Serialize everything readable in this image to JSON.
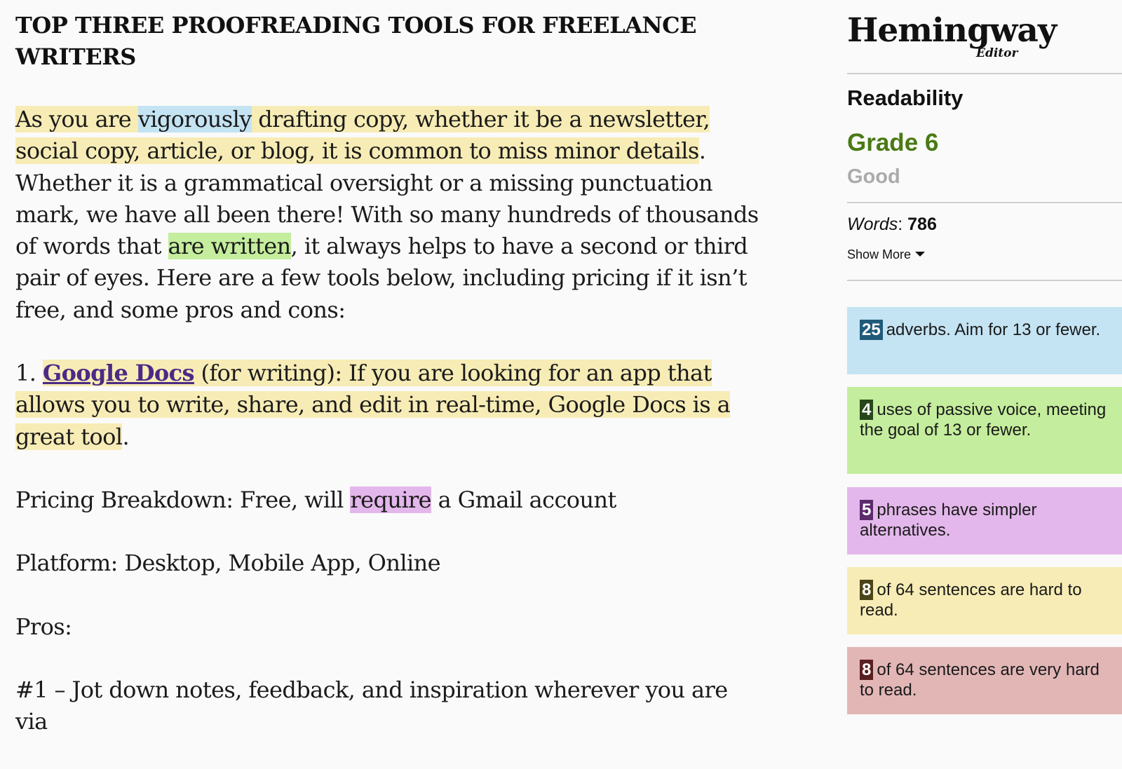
{
  "document": {
    "title": "TOP THREE PROOFREADING TOOLS FOR FREELANCE WRITERS",
    "p1": {
      "s1_a": "As you are ",
      "s1_adverb": "vigorously",
      "s1_b": " drafting copy, whether it be a newsletter, social copy, article, or blog, it is common to miss minor details",
      "s1_end": ". Whether it is a grammatical oversight or a missing punctuation mark, we have all been there! With so many hundreds of thousands of words that ",
      "passive": "are written",
      "tail": ", it always helps to have a second or third pair of eyes. Here are a few tools below, including pricing if it isn’t free, and some pros and cons:"
    },
    "p2": {
      "number": "1. ",
      "link": "Google Docs",
      "hard": " (for writing): If you are looking for an app that allows you to write, share, and edit in real-time, Google Docs is a great tool",
      "end": "."
    },
    "p3": {
      "a": "Pricing Breakdown: Free, will ",
      "simpler": "require",
      "b": " a Gmail account"
    },
    "p4": "Platform: Desktop, Mobile App, Online",
    "p5": "Pros:",
    "p6": "#1 – Jot down notes, feedback, and inspiration wherever you are via"
  },
  "sidebar": {
    "logo_main": "Hemingway",
    "logo_sub": "Editor",
    "readability_label": "Readability",
    "grade": "Grade 6",
    "grade_rating": "Good",
    "words_label": "Words",
    "words_sep": ": ",
    "words_value": "786",
    "show_more": "Show More",
    "cards": {
      "adverb": {
        "count": "25",
        "text": "adverbs. Aim for 13 or fewer."
      },
      "passive": {
        "count": "4",
        "text": "uses of passive voice, meeting the goal of 13 or fewer."
      },
      "simpler": {
        "count": "5",
        "text": "phrases have simpler alternatives."
      },
      "hard": {
        "count": "8",
        "text": "of 64 sentences are hard to read."
      },
      "veryhard": {
        "count": "8",
        "text": "of 64 sentences are very hard to read."
      }
    }
  },
  "colors": {
    "adverb": "#c4e3f3",
    "passive": "#c4ed9d",
    "simpler": "#e3b7eb",
    "hard": "#f7ecb5",
    "very_hard": "#e3b6b6",
    "grade": "#4a7a14",
    "link": "#4b2a86"
  },
  "icons": {
    "show_more": "caret-down-icon"
  }
}
